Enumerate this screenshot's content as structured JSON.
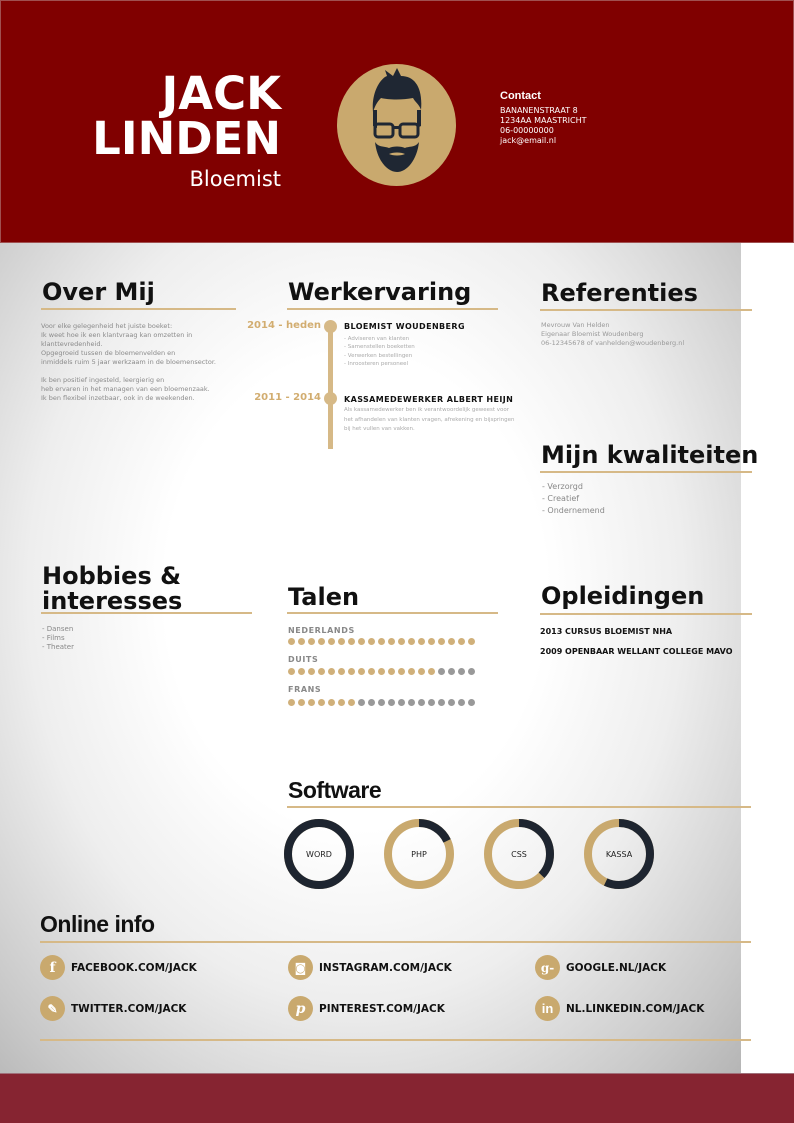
{
  "header": {
    "first_name": "JACK",
    "last_name": "LINDEN",
    "role": "Bloemist",
    "contact": {
      "title": "Contact",
      "lines": [
        "BANANENSTRAAT 8",
        "1234AA MAASTRICHT",
        "06-00000000",
        "jack@email.nl"
      ]
    }
  },
  "colors": {
    "header_bg": "#800000",
    "footer_bg": "#862431",
    "accent": "#c9a96e",
    "dark": "#1e2530"
  },
  "about": {
    "title": "Over Mij",
    "lines": [
      "Voor elke gelegenheid het juiste boeket:",
      "Ik weet hoe ik een klantvraag kan omzetten in klanttevredenheid.",
      "Opgegroeid tussen de bloemenvelden en",
      "inmiddels ruim 5 jaar werkzaam in de bloemensector.",
      "",
      "Ik ben positief ingesteld, leergierig en",
      "heb ervaren in het managen van een bloemenzaak.",
      "Ik ben flexibel inzetbaar, ook in de weekenden."
    ]
  },
  "experience": {
    "title": "Werkervaring",
    "jobs": [
      {
        "period": "2014 - heden",
        "title": "BLOEMIST WOUDENBERG",
        "tasks": [
          "- Adviseren van klanten",
          "- Samenstellen boeketten",
          "- Verwerken bestellingen",
          "- Inroosteren personeel"
        ]
      },
      {
        "period": "2011 - 2014",
        "title": "KASSAMEDEWERKER ALBERT HEIJN",
        "description": "Als kassamedewerker ben ik verantwoordelijk geweest voor het afhandelen van klanten vragen, afrekening en bijspringen bij het vullen van vakken."
      }
    ]
  },
  "references": {
    "title": "Referenties",
    "lines": [
      "Mevrouw Van Helden",
      "Eigenaar Bloemist Woudenberg",
      "06-12345678 of vanhelden@woudenberg.nl"
    ]
  },
  "qualities": {
    "title": "Mijn kwaliteiten",
    "items": [
      "- Verzorgd",
      "- Creatief",
      "- Ondernemend"
    ]
  },
  "hobbies": {
    "title_line1": "Hobbies &",
    "title_line2": "interesses",
    "items": [
      "- Dansen",
      "- Films",
      "- Theater"
    ]
  },
  "languages": {
    "title": "Talen",
    "total_dots": 19,
    "items": [
      {
        "name": "NEDERLANDS",
        "level": 19
      },
      {
        "name": "DUITS",
        "level": 15
      },
      {
        "name": "FRANS",
        "level": 7
      }
    ]
  },
  "education": {
    "title": "Opleidingen",
    "items": [
      "2013 CURSUS BLOEMIST NHA",
      "2009 OPENBAAR WELLANT COLLEGE MAVO"
    ]
  },
  "software": {
    "title": "Software",
    "items": [
      {
        "name": "WORD",
        "percent": 100
      },
      {
        "name": "PHP",
        "percent": 18
      },
      {
        "name": "CSS",
        "percent": 37
      },
      {
        "name": "KASSA",
        "percent": 57
      }
    ]
  },
  "online": {
    "title": "Online info",
    "links": [
      {
        "icon": "facebook-icon",
        "glyph": "f",
        "label": "FACEBOOK.COM/JACK"
      },
      {
        "icon": "instagram-icon",
        "glyph": "◙",
        "label": "INSTAGRAM.COM/JACK"
      },
      {
        "icon": "google-plus-icon",
        "glyph": "g-",
        "label": "GOOGLE.NL/JACK"
      },
      {
        "icon": "twitter-icon",
        "glyph": "✎",
        "label": "TWITTER.COM/JACK"
      },
      {
        "icon": "pinterest-icon",
        "glyph": "p",
        "label": "PINTEREST.COM/JACK"
      },
      {
        "icon": "linkedin-icon",
        "glyph": "in",
        "label": "NL.LINKEDIN.COM/JACK"
      }
    ]
  }
}
